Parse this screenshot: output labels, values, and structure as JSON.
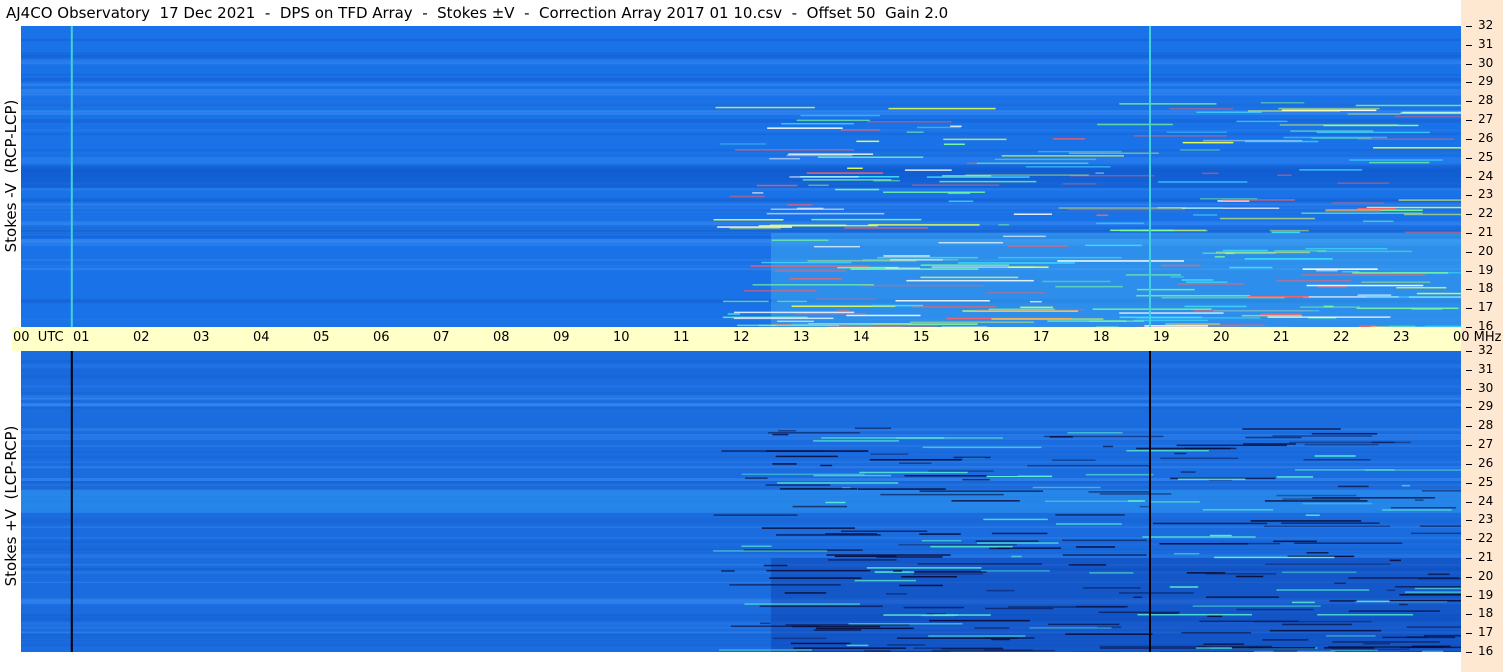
{
  "title": "AJ4CO Observatory  17 Dec 2021  -  DPS on TFD Array  -  Stokes ±V  -  Correction Array 2017 01 10.csv  -  Offset 50  Gain 2.0",
  "panels": [
    {
      "ylabel": "Stokes -V  (RCP-LCP)",
      "polarity": "positive",
      "base_color": "#1a72e8"
    },
    {
      "ylabel": "Stokes +V  (LCP-RCP)",
      "polarity": "negative",
      "base_color": "#1a6cdf"
    }
  ],
  "time_axis": {
    "start_label": "00  UTC",
    "end_label": "00 MHz",
    "hour_labels": [
      "01",
      "02",
      "03",
      "04",
      "05",
      "06",
      "07",
      "08",
      "09",
      "10",
      "11",
      "12",
      "13",
      "14",
      "15",
      "16",
      "17",
      "18",
      "19",
      "20",
      "21",
      "22",
      "23"
    ]
  },
  "chart_data": {
    "type": "heatmap",
    "x_unit": "UTC hour",
    "xlim": [
      0,
      24
    ],
    "y_unit": "MHz",
    "ylim": [
      16,
      32
    ],
    "yticks": [
      16,
      17,
      18,
      19,
      20,
      21,
      22,
      23,
      24,
      25,
      26,
      27,
      28,
      29,
      30,
      31,
      32
    ],
    "vertical_markers_utc": [
      0.83,
      18.8
    ],
    "activity_window_utc": [
      11.5,
      24
    ]
  },
  "colors": {
    "title_bg": "#ffffff",
    "timebar_bg": "#ffffc8",
    "right_strip_bg": "#ffe8d2",
    "marker_top": "#3fd3e0",
    "marker_bottom": "#000000"
  }
}
